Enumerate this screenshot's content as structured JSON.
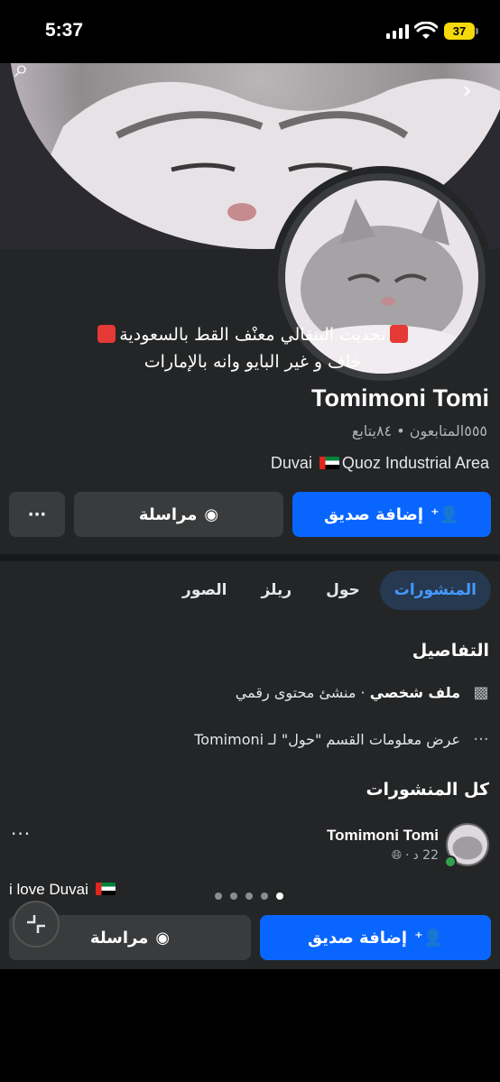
{
  "status_bar": {
    "time": "5:37",
    "battery": "37"
  },
  "profile": {
    "bio_line1": "تحديث البنقالي معنْف القط بالسعودية",
    "bio_line2": "خاف و غير البايو وانه بالإمارات",
    "name": "Tomimoni Tomi",
    "stats": "٥٥٥المتابعون • ٨٤يتابع",
    "location_prefix": "Duvai",
    "location_suffix": "Quoz Industrial Area"
  },
  "actions": {
    "add_friend": "إضافة صديق",
    "message": "مراسلة",
    "more": "···"
  },
  "tabs": [
    "المنشورات",
    "حول",
    "ريلز",
    "الصور"
  ],
  "details": {
    "title": "التفاصيل",
    "profile_type_bold": "ملف شخصي",
    "profile_type_rest": " · منشئ محتوى رقمي",
    "about_link": "عرض معلومات القسم \"حول\" لـ Tomimoni",
    "icons": {
      "profile": "film-icon",
      "more": "more-dots-icon"
    }
  },
  "posts": {
    "title": "كل المنشورات",
    "author": "Tomimoni Tomi",
    "time": "22 د",
    "text": "i love Duvai",
    "carousel_active_index": 4
  },
  "sticky_bar": {
    "add_friend": "إضافة صديق",
    "message": "مراسلة"
  },
  "colors": {
    "accent": "#0866ff",
    "bg": "#242526",
    "active_tab_bg": "#263951",
    "active_tab_text": "#4599ff"
  }
}
